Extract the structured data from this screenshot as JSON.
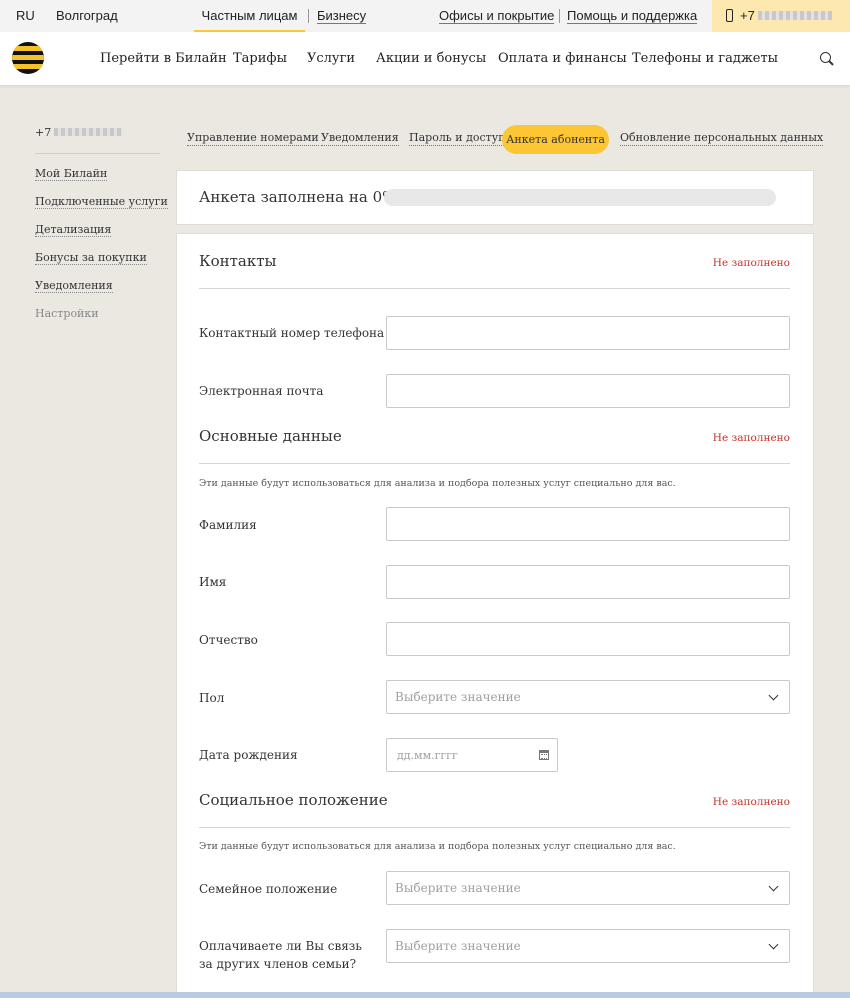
{
  "topbar": {
    "lang": "RU",
    "city": "Волгоград",
    "segment_private": "Частным лицам",
    "segment_business": "Бизнесу",
    "offices": "Офисы и покрытие",
    "help": "Помощь и поддержка",
    "phone_prefix": "+7"
  },
  "nav": {
    "items": [
      "Перейти в Билайн",
      "Тарифы",
      "Услуги",
      "Акции и бонусы",
      "Оплата и финансы",
      "Телефоны и гаджеты"
    ]
  },
  "sidebar": {
    "phone_prefix": "+7",
    "items": [
      "Мой Билайн",
      "Подключенные услуги",
      "Детализация",
      "Бонусы за покупки",
      "Уведомления",
      "Настройки"
    ]
  },
  "tabs": {
    "items": [
      "Управление номерами",
      "Уведомления",
      "Пароль и доступ",
      "Анкета абонента",
      "Обновление персональных данных"
    ],
    "active": "Анкета абонента"
  },
  "progress": {
    "label": "Анкета заполнена на 0%",
    "value": 0
  },
  "sections": {
    "contacts": {
      "title": "Контакты",
      "status": "Не заполнено",
      "fields": [
        "Контактный номер телефона",
        "Электронная почта"
      ]
    },
    "basic": {
      "title": "Основные данные",
      "status": "Не заполнено",
      "note": "Эти данные будут использоваться для анализа и подбора полезных услуг специально для вас.",
      "fields": [
        "Фамилия",
        "Имя",
        "Отчество",
        "Пол",
        "Дата рождения"
      ],
      "gender_placeholder": "Выберите значение",
      "date_placeholder": "дд.мм.гггг"
    },
    "social": {
      "title": "Социальное положение",
      "status": "Не заполнено",
      "note": "Эти данные будут использоваться для анализа и подбора полезных услуг специально для вас.",
      "fields": [
        "Семейное положение",
        "Оплачиваете ли Вы связь за других членов семьи?"
      ],
      "select_placeholder": "Выберите значение"
    }
  },
  "colors": {
    "brand_yellow": "#fcc634",
    "status_red": "#c4342b",
    "background": "#ebe8e2"
  }
}
